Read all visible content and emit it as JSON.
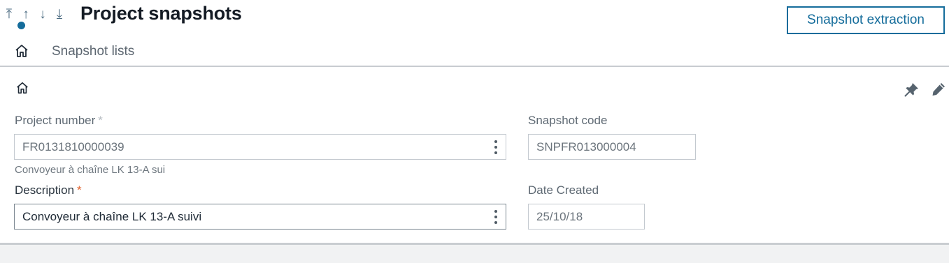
{
  "header": {
    "title": "Project snapshots",
    "nav_arrows": [
      "⤒",
      "↑",
      "↓",
      "⤓"
    ],
    "extract_button": "Snapshot extraction"
  },
  "tabs": {
    "home_icon": "home-icon",
    "lists_label": "Snapshot lists"
  },
  "form": {
    "project_number": {
      "label": "Project number",
      "required_mark": "*",
      "value": "FR0131810000039",
      "hint": "Convoyeur à chaîne LK 13-A sui"
    },
    "description": {
      "label": "Description",
      "required_mark": "*",
      "value": "Convoyeur à chaîne LK 13-A suivi"
    },
    "snapshot_code": {
      "label": "Snapshot code",
      "value": "SNPFR013000004"
    },
    "date_created": {
      "label": "Date Created",
      "value": "25/10/18"
    }
  },
  "colors": {
    "accent": "#146c9b",
    "required_orange": "#e0602a"
  }
}
